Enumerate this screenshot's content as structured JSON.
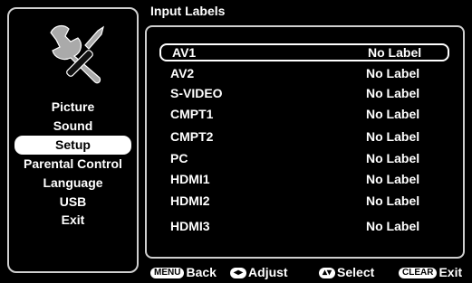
{
  "sidebar": {
    "icon": "tools-icon",
    "items": [
      {
        "label": "Picture"
      },
      {
        "label": "Sound"
      },
      {
        "label": "Setup"
      },
      {
        "label": "Parental Control"
      },
      {
        "label": "Language"
      },
      {
        "label": "USB"
      },
      {
        "label": "Exit"
      }
    ],
    "selected": "Setup"
  },
  "panel": {
    "title": "Input Labels",
    "rows": [
      {
        "name": "AV1",
        "value": "No Label"
      },
      {
        "name": "AV2",
        "value": "No Label"
      },
      {
        "name": "S-VIDEO",
        "value": "No Label"
      },
      {
        "name": "CMPT1",
        "value": "No Label"
      },
      {
        "name": "CMPT2",
        "value": "No Label"
      },
      {
        "name": "PC",
        "value": "No Label"
      },
      {
        "name": "HDMI1",
        "value": "No Label"
      },
      {
        "name": "HDMI2",
        "value": "No Label"
      },
      {
        "name": "HDMI3",
        "value": "No Label"
      }
    ],
    "selected_row": "AV1"
  },
  "footer": {
    "menu_key": "MENU",
    "back": "Back",
    "adjust_key": "◂▸",
    "adjust": "Adjust",
    "select_key": "▴▾",
    "select": "Select",
    "clear_key": "CLEAR",
    "exit": "Exit"
  },
  "colors": {
    "background": "#000000",
    "border": "#cfcfcf",
    "highlight": "#ffffff"
  }
}
